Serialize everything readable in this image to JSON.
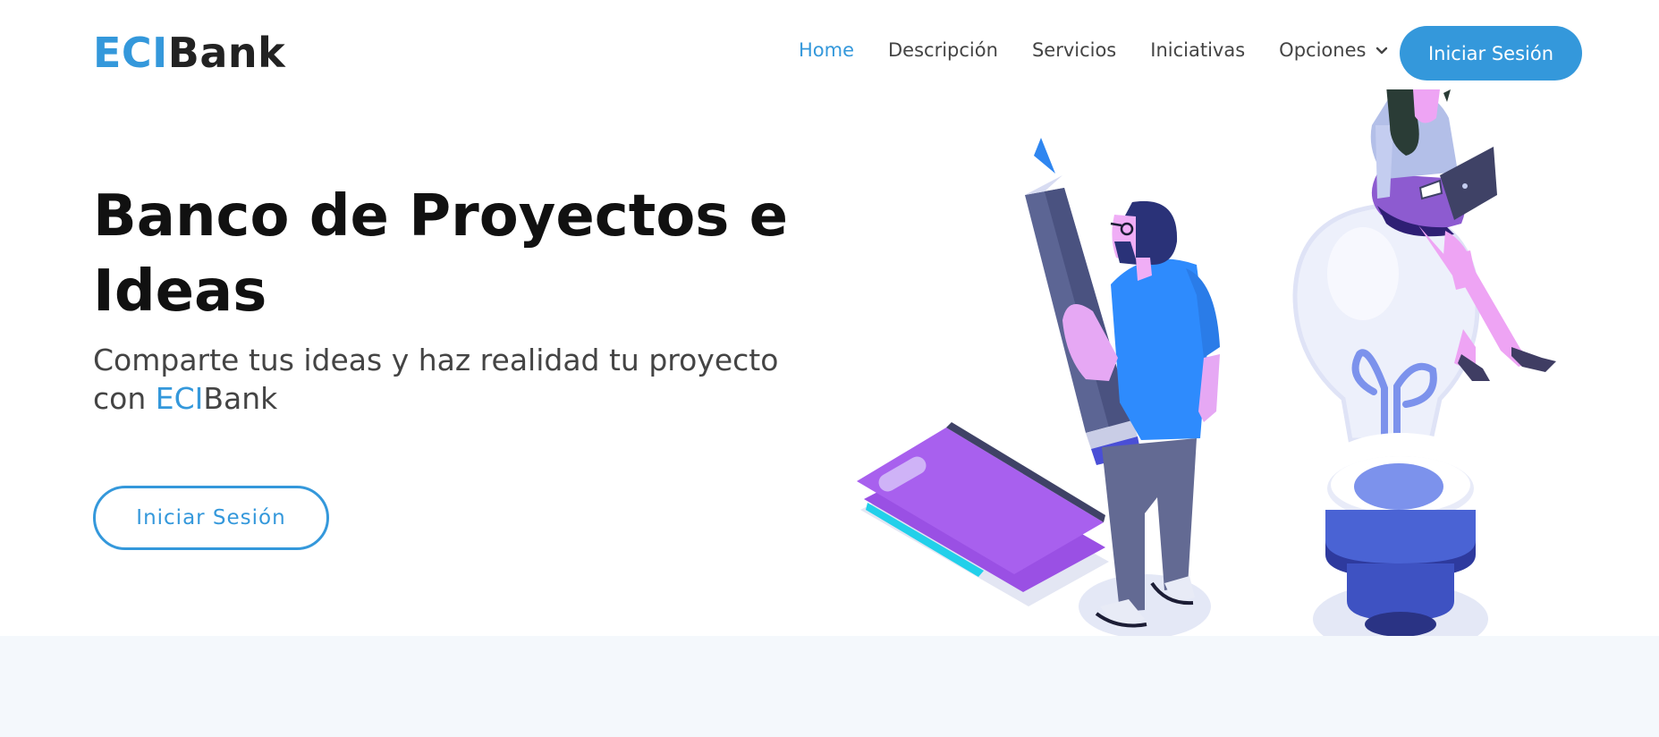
{
  "logo": {
    "part1": "ECI",
    "part2": "Bank"
  },
  "nav": {
    "items": [
      {
        "label": "Home",
        "active": true
      },
      {
        "label": "Descripción",
        "active": false
      },
      {
        "label": "Servicios",
        "active": false
      },
      {
        "label": "Iniciativas",
        "active": false
      },
      {
        "label": "Opciones",
        "active": false
      }
    ],
    "login_label": "Iniciar Sesión"
  },
  "hero": {
    "title": "Banco de Proyectos e Ideas",
    "subtitle_text": "Comparte tus ideas y haz realidad tu proyecto con ",
    "subtitle_brand1": "ECI",
    "subtitle_brand2": "Bank",
    "cta_label": "Iniciar Sesión"
  },
  "icons": {
    "options_dropdown": "chevron-down-icon"
  },
  "colors": {
    "accent": "#3498db",
    "text_dark": "#111111",
    "band_bg": "#f4f8fc"
  }
}
